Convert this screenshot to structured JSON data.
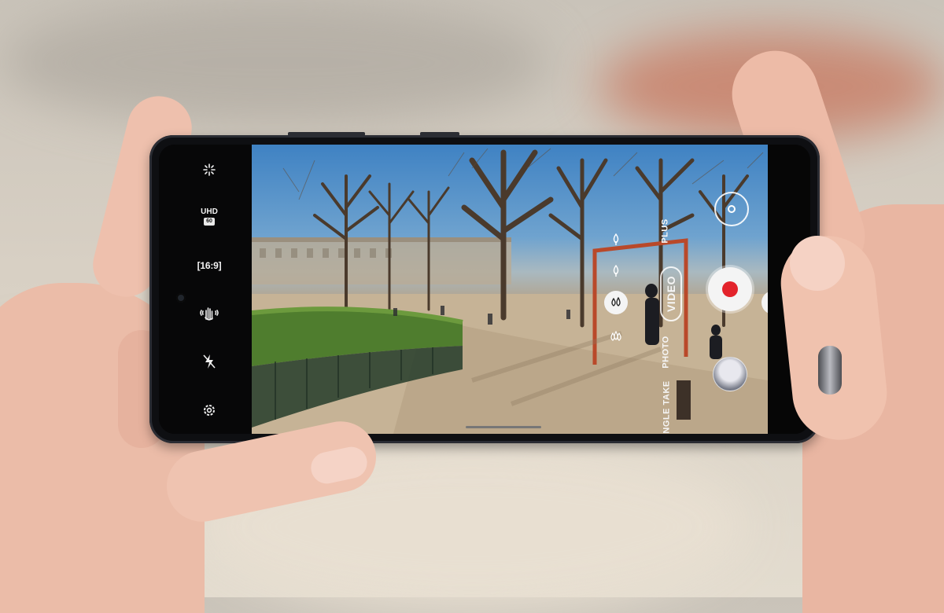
{
  "camera": {
    "left_rail": {
      "effects_icon": "sparkle-icon",
      "resolution": {
        "label": "UHD",
        "fps": "60"
      },
      "aspect_ratio": "16:9",
      "stabilization_icon": "hand-shake-icon",
      "flash_icon": "flash-off-icon",
      "settings_icon": "gear-icon"
    },
    "modes": {
      "plus": "PLUS",
      "video": "VIDEO",
      "photo": "PHOTO",
      "single_take": "NGLE TAKE"
    },
    "controls": {
      "record_icon": "record-icon",
      "switch_camera_icon": "switch-camera-icon",
      "gallery_icon": "gallery-thumbnail"
    },
    "zoom_levels_icons": [
      "tree-icon",
      "tree-icon",
      "tree-double-icon",
      "tree-triple-icon"
    ],
    "colors": {
      "record": "#e3232b",
      "ui_white": "#f4f4f4"
    }
  }
}
